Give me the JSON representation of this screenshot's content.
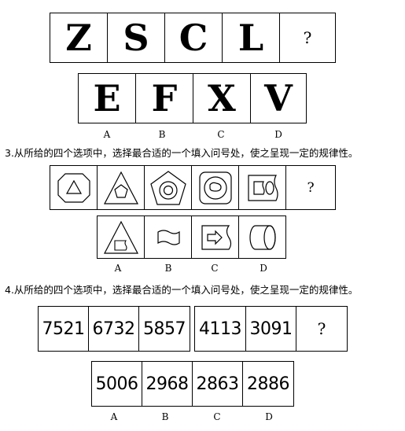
{
  "q2": {
    "sequence": [
      "Z",
      "S",
      "C",
      "L",
      "?"
    ],
    "options": [
      "E",
      "F",
      "X",
      "V"
    ],
    "option_labels": [
      "A",
      "B",
      "C",
      "D"
    ]
  },
  "q3": {
    "heading": "3.从所给的四个选项中，选择最合适的一个填入问号处，使之呈现一定的规律性。",
    "question_mark": "?",
    "option_labels": [
      "A",
      "B",
      "C",
      "D"
    ]
  },
  "q4": {
    "heading": "4.从所给的四个选项中，选择最合适的一个填入问号处，使之呈现一定的规律性。",
    "group1": [
      "7521",
      "6732",
      "5857"
    ],
    "group2": [
      "4113",
      "3091"
    ],
    "question_mark": "?",
    "options": [
      "5006",
      "2968",
      "2863",
      "2886"
    ],
    "option_labels": [
      "A",
      "B",
      "C",
      "D"
    ]
  }
}
